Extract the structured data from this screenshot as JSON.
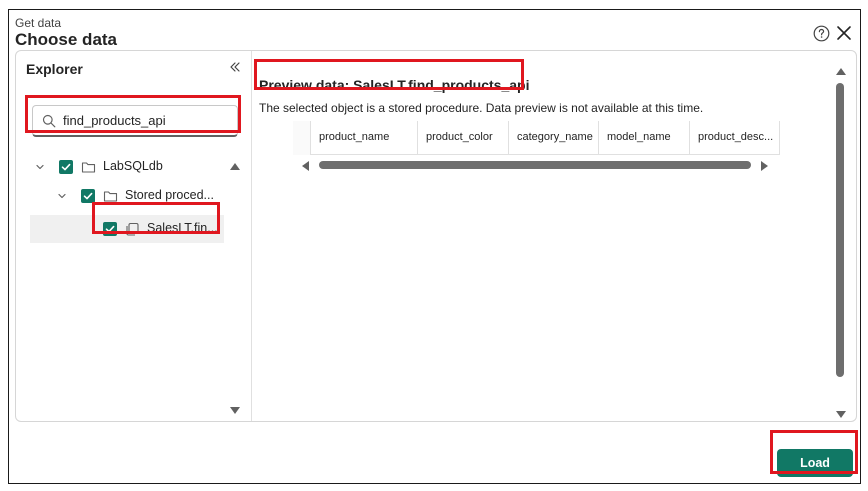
{
  "dialog": {
    "subtitle": "Get data",
    "title": "Choose data",
    "icons": {
      "help": "help-circle-icon",
      "close": "close-icon"
    }
  },
  "explorer": {
    "title": "Explorer",
    "collapse_icon": "double-chevron-left-icon",
    "search": {
      "value": "find_products_api",
      "icon": "search-icon"
    },
    "tree": [
      {
        "label": "LabSQLdb",
        "checked": true,
        "expanded": true,
        "icon": "folder-icon",
        "level": 0
      },
      {
        "label": "Stored proced...",
        "checked": true,
        "expanded": true,
        "icon": "folder-icon",
        "level": 1
      },
      {
        "label": "SalesLT.fin...",
        "checked": true,
        "selected": true,
        "icon": "stored-procedure-icon",
        "level": 2
      }
    ]
  },
  "preview": {
    "title": "Preview data: SalesLT.find_products_api",
    "message": "The selected object is a stored procedure. Data preview is not available at this time.",
    "columns": [
      "product_name",
      "product_color",
      "category_name",
      "model_name",
      "product_desc..."
    ]
  },
  "footer": {
    "load_label": "Load"
  },
  "colors": {
    "accent": "#117865",
    "highlight": "#e0171f"
  }
}
